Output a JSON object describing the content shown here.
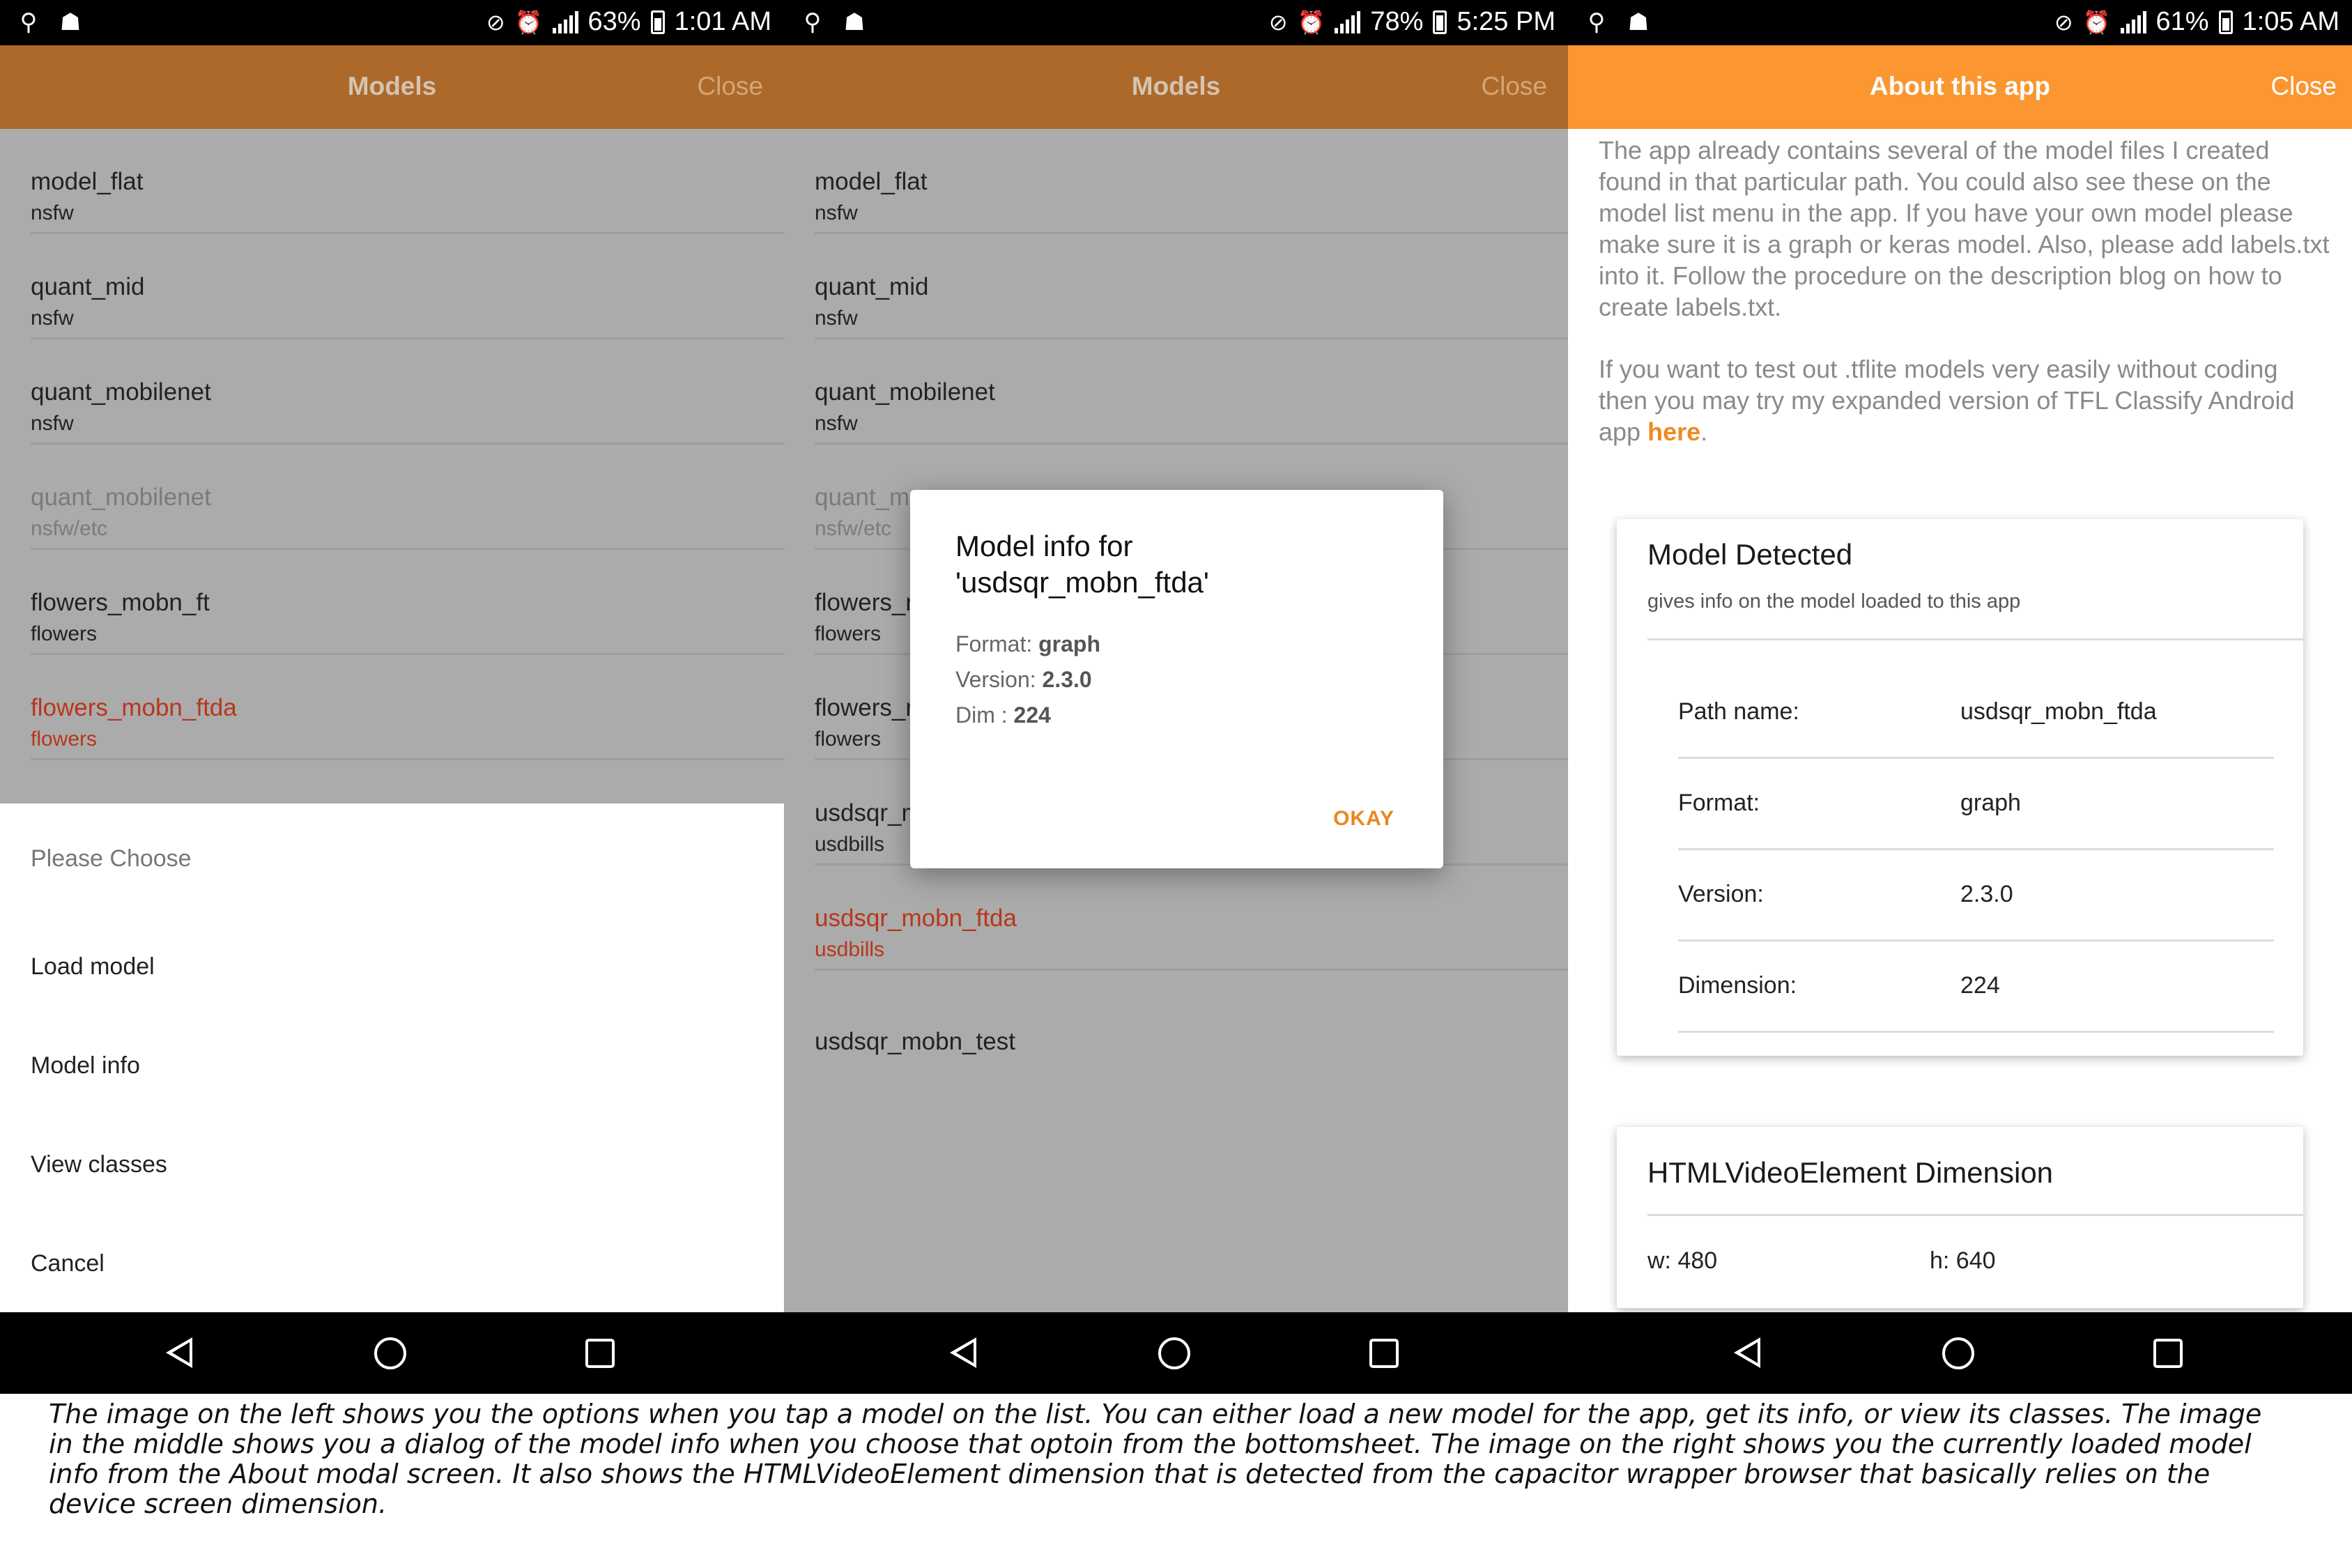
{
  "left": {
    "status": {
      "battery": "63%",
      "time": "1:01 AM"
    },
    "header": {
      "title": "Models",
      "close": "Close"
    },
    "models": [
      {
        "name": "model_flat",
        "sub": "nsfw"
      },
      {
        "name": "quant_mid",
        "sub": "nsfw"
      },
      {
        "name": "quant_mobilenet",
        "sub": "nsfw"
      },
      {
        "name": "quant_mobilenet",
        "sub": "nsfw/etc"
      },
      {
        "name": "flowers_mobn_ft",
        "sub": "flowers"
      },
      {
        "name": "flowers_mobn_ftda",
        "sub": "flowers"
      }
    ],
    "sheet": {
      "title": "Please Choose",
      "options": [
        "Load model",
        "Model info",
        "View classes",
        "Cancel"
      ]
    }
  },
  "middle": {
    "status": {
      "battery": "78%",
      "time": "5:25 PM"
    },
    "header": {
      "title": "Models",
      "close": "Close"
    },
    "models": [
      {
        "name": "model_flat",
        "sub": "nsfw"
      },
      {
        "name": "quant_mid",
        "sub": "nsfw"
      },
      {
        "name": "quant_mobilenet",
        "sub": "nsfw"
      },
      {
        "name": "quant_m",
        "sub": "nsfw/etc"
      },
      {
        "name": "flowers_r",
        "sub": "flowers"
      },
      {
        "name": "flowers_r",
        "sub": "flowers"
      },
      {
        "name": "usdsqr_m",
        "sub": "usdbills"
      },
      {
        "name": "usdsqr_mobn_ftda",
        "sub": "usdbills"
      },
      {
        "name": "usdsqr_mobn_test",
        "sub": ""
      }
    ],
    "dialog": {
      "title": "Model info for 'usdsqr_mobn_ftda'",
      "format_label": "Format:",
      "format_value": "graph",
      "version_label": "Version:",
      "version_value": "2.3.0",
      "dim_label": "Dim :",
      "dim_value": "224",
      "okay": "OKAY"
    }
  },
  "right": {
    "status": {
      "battery": "61%",
      "time": "1:05 AM"
    },
    "header": {
      "title": "About this app",
      "close": "Close"
    },
    "para1": "The app already contains several of the model files I created found in that particular path. You could also see these on the model list menu in the app. If you have your own model please make sure it is a graph or keras model. Also, please add labels.txt into it. Follow the procedure on the description blog on how to create labels.txt.",
    "para2": "If you want to test out .tflite models very easily without coding then you may try my expanded version of TFL Classify Android app",
    "link": "here",
    "after_link": ".",
    "card1": {
      "title": "Model Detected",
      "subtitle": "gives info on the model loaded to this app",
      "rows": [
        {
          "label": "Path name:",
          "value": "usdsqr_mobn_ftda"
        },
        {
          "label": "Format:",
          "value": "graph"
        },
        {
          "label": "Version:",
          "value": "2.3.0"
        },
        {
          "label": "Dimension:",
          "value": "224"
        }
      ]
    },
    "card2": {
      "title": "HTMLVideoElement Dimension",
      "w": "w: 480",
      "h": "h: 640"
    }
  },
  "caption": "The image on the left shows you the options when you tap a model on the list. You can either load a new model for the app, get its info, or view its classes. The image in the middle shows you a dialog of the model info when you choose that optoin from the bottomsheet. The image on the right shows you the currently loaded model info from the About modal screen. It also shows the HTMLVideoElement dimension that is detected from the capacitor wrapper browser that basically relies on the device screen dimension.",
  "colors": {
    "header_dim": "#ad6929",
    "header_bright": "#fb9630",
    "selected_text": "#b9361a",
    "accent": "#e8881e"
  },
  "icons": [
    "usb-icon",
    "android-debug-icon",
    "mute-icon",
    "alarm-icon",
    "data-icon",
    "signal-icon",
    "battery-icon",
    "nav-back-icon",
    "nav-home-icon",
    "nav-recent-icon"
  ]
}
